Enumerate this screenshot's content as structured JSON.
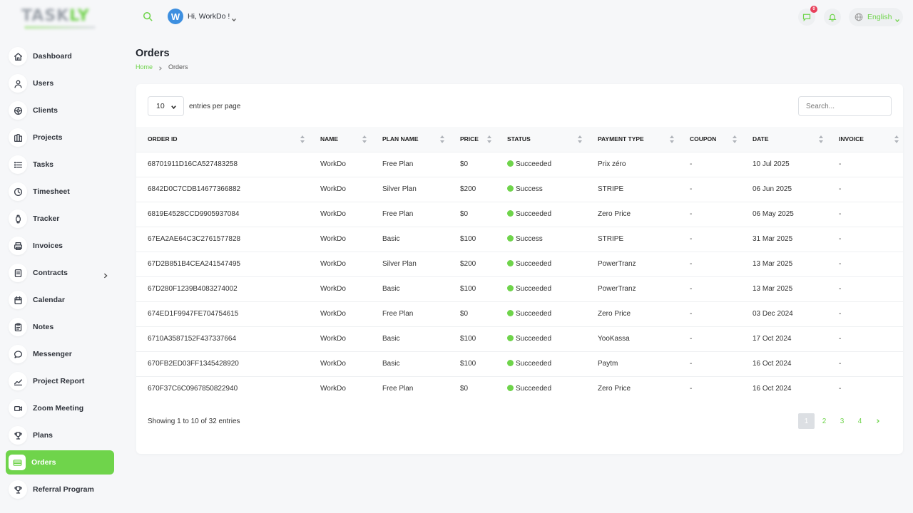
{
  "logo": {
    "text_main": "TASK",
    "text_accent": "LY"
  },
  "header": {
    "avatar_initial": "W",
    "greeting": "Hi, WorkDo !",
    "chat_badge": "0",
    "language": "English"
  },
  "sidebar": {
    "items": [
      {
        "label": "Dashboard",
        "icon": "home-icon"
      },
      {
        "label": "Users",
        "icon": "user-icon"
      },
      {
        "label": "Clients",
        "icon": "clients-icon"
      },
      {
        "label": "Projects",
        "icon": "projects-icon"
      },
      {
        "label": "Tasks",
        "icon": "tasks-icon"
      },
      {
        "label": "Timesheet",
        "icon": "clock-icon"
      },
      {
        "label": "Tracker",
        "icon": "watch-icon"
      },
      {
        "label": "Invoices",
        "icon": "printer-icon"
      },
      {
        "label": "Contracts",
        "icon": "contract-icon"
      },
      {
        "label": "Calendar",
        "icon": "calendar-icon"
      },
      {
        "label": "Notes",
        "icon": "notes-icon"
      },
      {
        "label": "Messenger",
        "icon": "chat-icon"
      },
      {
        "label": "Project Report",
        "icon": "report-icon"
      },
      {
        "label": "Zoom Meeting",
        "icon": "video-icon"
      },
      {
        "label": "Plans",
        "icon": "trophy-icon"
      },
      {
        "label": "Orders",
        "icon": "card-icon"
      },
      {
        "label": "Referral Program",
        "icon": "trophy-icon"
      }
    ]
  },
  "page": {
    "title": "Orders",
    "breadcrumb_home": "Home",
    "breadcrumb_current": "Orders"
  },
  "table": {
    "entries_value": "10",
    "entries_label": "entries per page",
    "search_placeholder": "Search...",
    "columns": [
      "ORDER ID",
      "NAME",
      "PLAN NAME",
      "PRICE",
      "STATUS",
      "PAYMENT TYPE",
      "COUPON",
      "DATE",
      "INVOICE"
    ],
    "rows": [
      [
        "68701911D16CA527483258",
        "WorkDo",
        "Free Plan",
        "$0",
        "Succeeded",
        "Prix zéro",
        "-",
        "10 Jul 2025",
        "-"
      ],
      [
        "6842D0C7CDB14677366882",
        "WorkDo",
        "Silver Plan",
        "$200",
        "Success",
        "STRIPE",
        "-",
        "06 Jun 2025",
        "-"
      ],
      [
        "6819E4528CCD9905937084",
        "WorkDo",
        "Free Plan",
        "$0",
        "Succeeded",
        "Zero Price",
        "-",
        "06 May 2025",
        "-"
      ],
      [
        "67EA2AE64C3C2761577828",
        "WorkDo",
        "Basic",
        "$100",
        "Success",
        "STRIPE",
        "-",
        "31 Mar 2025",
        "-"
      ],
      [
        "67D2B851B4CEA241547495",
        "WorkDo",
        "Silver Plan",
        "$200",
        "Succeeded",
        "PowerTranz",
        "-",
        "13 Mar 2025",
        "-"
      ],
      [
        "67D280F1239B4083274002",
        "WorkDo",
        "Basic",
        "$100",
        "Succeeded",
        "PowerTranz",
        "-",
        "13 Mar 2025",
        "-"
      ],
      [
        "674ED1F9947FE704754615",
        "WorkDo",
        "Free Plan",
        "$0",
        "Succeeded",
        "Zero Price",
        "-",
        "03 Dec 2024",
        "-"
      ],
      [
        "6710A3587152F437337664",
        "WorkDo",
        "Basic",
        "$100",
        "Succeeded",
        "YooKassa",
        "-",
        "17 Oct 2024",
        "-"
      ],
      [
        "670FB2ED03FF1345428920",
        "WorkDo",
        "Basic",
        "$100",
        "Succeeded",
        "Paytm",
        "-",
        "16 Oct 2024",
        "-"
      ],
      [
        "670F37C6C0967850822940",
        "WorkDo",
        "Free Plan",
        "$0",
        "Succeeded",
        "Zero Price",
        "-",
        "16 Oct 2024",
        "-"
      ]
    ],
    "showing": "Showing 1 to 10 of 32 entries",
    "pages": [
      "1",
      "2",
      "3",
      "4"
    ],
    "active_page": "1",
    "status_color": "#6fd44b"
  },
  "colors": {
    "accent": "#6fd44b",
    "avatar": "#3d8fe0",
    "badge": "#e8415b"
  }
}
